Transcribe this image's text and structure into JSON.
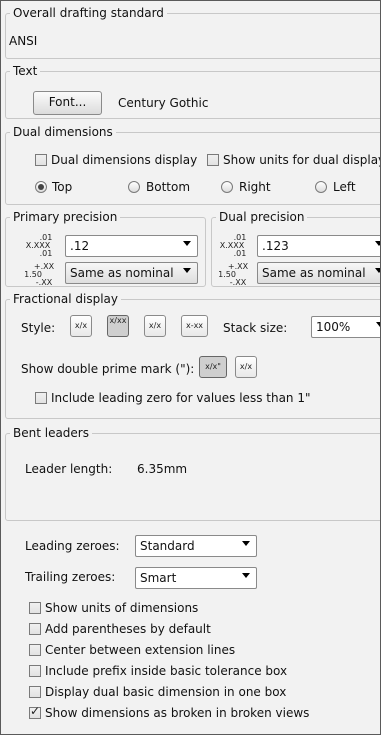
{
  "standard": {
    "legend": "Overall drafting standard",
    "value": "ANSI"
  },
  "text": {
    "legend": "Text",
    "font_button": "Font...",
    "font_name": "Century Gothic"
  },
  "dual": {
    "legend": "Dual dimensions",
    "display_label": "Dual dimensions display",
    "display_checked": false,
    "units_label": "Show units for dual display",
    "units_checked": false,
    "positions": [
      {
        "label": "Top",
        "selected": true
      },
      {
        "label": "Bottom",
        "selected": false
      },
      {
        "label": "Right",
        "selected": false
      },
      {
        "label": "Left",
        "selected": false
      }
    ]
  },
  "primary": {
    "legend": "Primary precision",
    "value_icon": {
      "top": ".01",
      "mid": "X.XXX",
      "bot": ".01"
    },
    "value": ".12",
    "tol_icon": {
      "top": "+.XX",
      "mid": "1.50",
      "bot": "-.XX"
    },
    "tol": "Same as nominal"
  },
  "dualprec": {
    "legend": "Dual precision",
    "value_icon": {
      "top": ".01",
      "mid": "X.XXX",
      "bot": ".01"
    },
    "value": ".123",
    "tol_icon": {
      "top": "+.XX",
      "mid": "1.50",
      "bot": "-.XX"
    },
    "tol": "Same as nominal"
  },
  "fractional": {
    "legend": "Fractional display",
    "style_label": "Style:",
    "style_icons": [
      "x/x",
      "x/xx",
      "x/x",
      "x-xx"
    ],
    "stack_label": "Stack size:",
    "stack_value": "100%",
    "prime_label": "Show double prime mark (\"):",
    "prime_icons": [
      "x/x\"",
      "x/x"
    ],
    "leading_label": "Include leading zero for values less than 1\"",
    "leading_checked": false
  },
  "bent": {
    "legend": "Bent leaders",
    "length_label": "Leader length:",
    "length_value": "6.35mm"
  },
  "zeroes": {
    "leading_label": "Leading zeroes:",
    "leading_value": "Standard",
    "trailing_label": "Trailing zeroes:",
    "trailing_value": "Smart"
  },
  "options": [
    {
      "label": "Show units of dimensions",
      "checked": false
    },
    {
      "label": "Add parentheses by default",
      "checked": false
    },
    {
      "label": "Center between extension lines",
      "checked": false
    },
    {
      "label": "Include prefix inside basic tolerance box",
      "checked": false
    },
    {
      "label": "Display dual basic dimension in one box",
      "checked": false
    },
    {
      "label": "Show dimensions as broken in broken views",
      "checked": true
    }
  ]
}
